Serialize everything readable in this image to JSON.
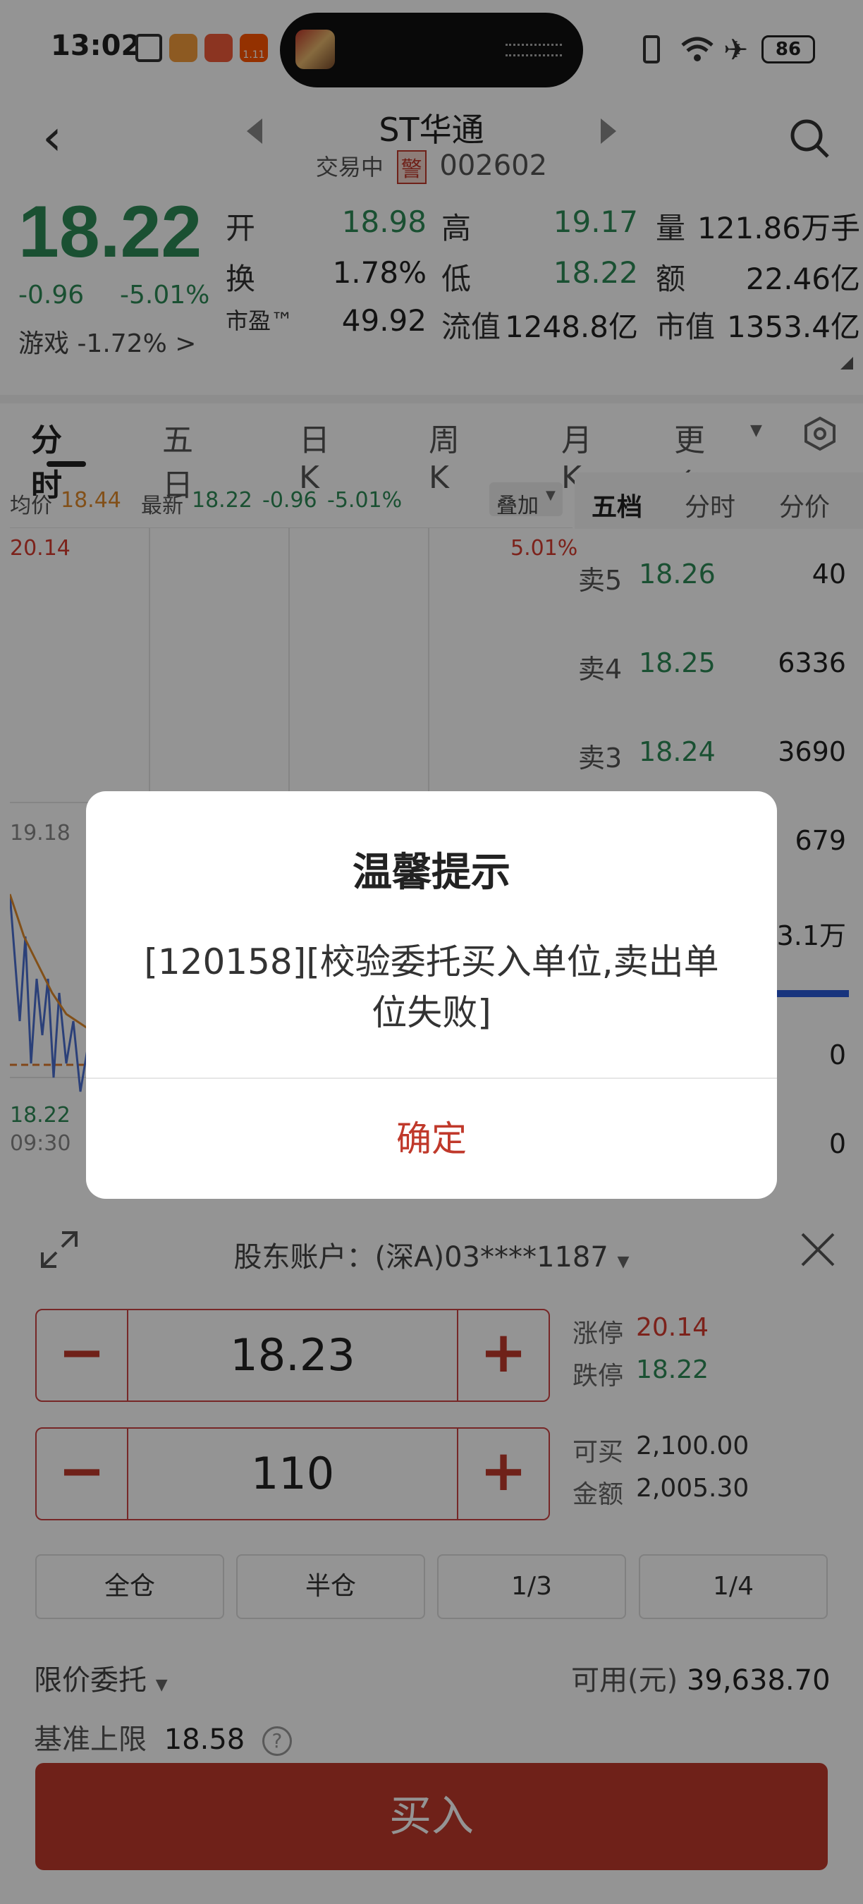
{
  "status_bar": {
    "time": "13:02",
    "battery": "86",
    "badge_text": "1.11"
  },
  "header": {
    "stock_name": "ST华通",
    "trading_status": "交易中",
    "warning_badge": "警",
    "stock_code": "002602"
  },
  "quote": {
    "price": "18.22",
    "change": "-0.96",
    "change_pct": "-5.01%",
    "sector": "游戏 -1.72% >",
    "rows": [
      [
        {
          "l": "开",
          "v": "18.98",
          "c": "green"
        },
        {
          "l": "高",
          "v": "19.17",
          "c": "green"
        },
        {
          "l": "量",
          "v": "121.86万手",
          "c": "dark"
        }
      ],
      [
        {
          "l": "换",
          "v": "1.78%",
          "c": "dark"
        },
        {
          "l": "低",
          "v": "18.22",
          "c": "green"
        },
        {
          "l": "额",
          "v": "22.46亿",
          "c": "dark"
        }
      ],
      [
        {
          "l": "市盈™",
          "v": "49.92",
          "c": "dark"
        },
        {
          "l": "流值",
          "v": "1248.8亿",
          "c": "dark"
        },
        {
          "l": "市值",
          "v": "1353.4亿",
          "c": "dark"
        }
      ]
    ]
  },
  "tabs": [
    "分时",
    "五日",
    "日K",
    "周K",
    "月K",
    "更多"
  ],
  "chart": {
    "avg_label": "均价",
    "avg_value": "18.44",
    "latest_label": "最新",
    "latest_value": "18.22",
    "latest_change": "-0.96",
    "latest_pct": "-5.01%",
    "overlay_button": "叠加",
    "y_top": "20.14",
    "y_mid": "19.18",
    "y_bottom": "18.22",
    "pct_top": "5.01%",
    "time_start": "09:30"
  },
  "orderbook": {
    "tabs": [
      "五档",
      "分时",
      "分价"
    ],
    "rows": [
      {
        "label": "卖5",
        "price": "18.26",
        "vol": "40"
      },
      {
        "label": "卖4",
        "price": "18.25",
        "vol": "6336"
      },
      {
        "label": "卖3",
        "price": "18.24",
        "vol": "3690"
      },
      {
        "label": "",
        "price": "",
        "vol": "679"
      },
      {
        "label": "",
        "price": "",
        "vol": "3.1万"
      },
      {
        "label": "",
        "price": "",
        "vol": "0"
      },
      {
        "label": "",
        "price": "",
        "vol": "0"
      }
    ]
  },
  "trade": {
    "account_label": "股东账户：(深A)03****1187",
    "price_value": "18.23",
    "quantity_value": "110",
    "limit_up_label": "涨停",
    "limit_up_value": "20.14",
    "limit_down_label": "跌停",
    "limit_down_value": "18.22",
    "can_buy_label": "可买",
    "can_buy_value": "2,100.00",
    "amount_label": "金额",
    "amount_value": "2,005.30",
    "ratios": [
      "全仓",
      "半仓",
      "1/3",
      "1/4"
    ],
    "order_type": "限价委托",
    "available_label": "可用(元)",
    "available_value": "39,638.70",
    "upper_limit_label": "基准上限",
    "upper_limit_value": "18.58",
    "buy_button": "买入"
  },
  "dialog": {
    "title": "温馨提示",
    "message": "[120158][校验委托买入单位,卖出单位失败]",
    "confirm": "确定"
  },
  "colors": {
    "green": "#2e8b57",
    "red": "#c0392b",
    "overlay": "rgba(0,0,0,0.42)"
  }
}
